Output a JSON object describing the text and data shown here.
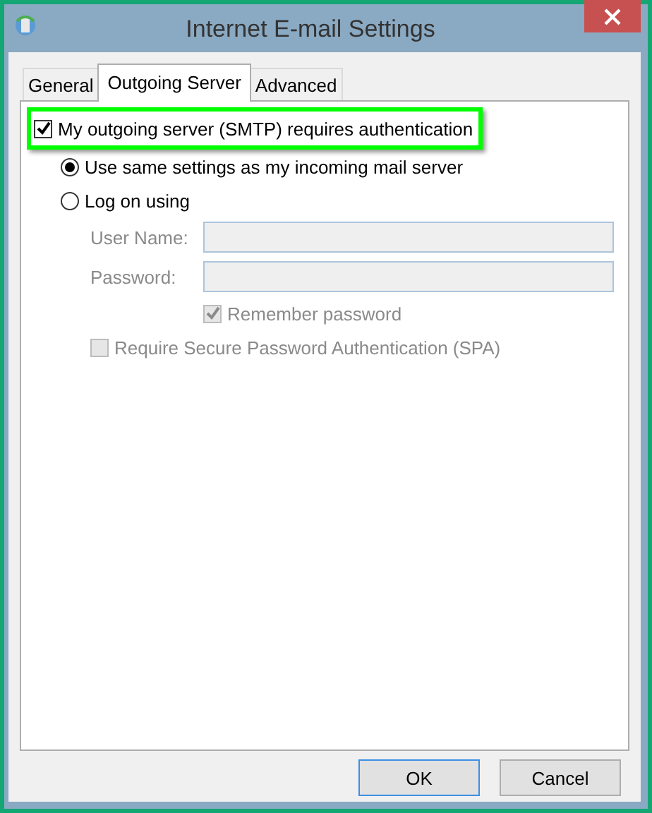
{
  "window": {
    "title": "Internet E-mail Settings"
  },
  "tabs": [
    {
      "label": "General",
      "selected": false
    },
    {
      "label": "Outgoing Server",
      "selected": true
    },
    {
      "label": "Advanced",
      "selected": false
    }
  ],
  "auth": {
    "label": "My outgoing server (SMTP) requires authentication",
    "checked": true,
    "highlighted": true
  },
  "options": [
    {
      "label": "Use same settings as my incoming mail server",
      "selected": true
    },
    {
      "label": "Log on using",
      "selected": false
    }
  ],
  "fields": [
    {
      "label": "User Name:",
      "disabled": true
    },
    {
      "label": "Password:",
      "disabled": true
    }
  ],
  "remember": {
    "label": "Remember password",
    "checked": true,
    "disabled": true
  },
  "spa": {
    "label": "Require Secure Password Authentication (SPA)",
    "checked": false,
    "disabled": true
  },
  "buttons": [
    {
      "label": "OK",
      "default": true
    },
    {
      "label": "Cancel",
      "default": false
    }
  ]
}
